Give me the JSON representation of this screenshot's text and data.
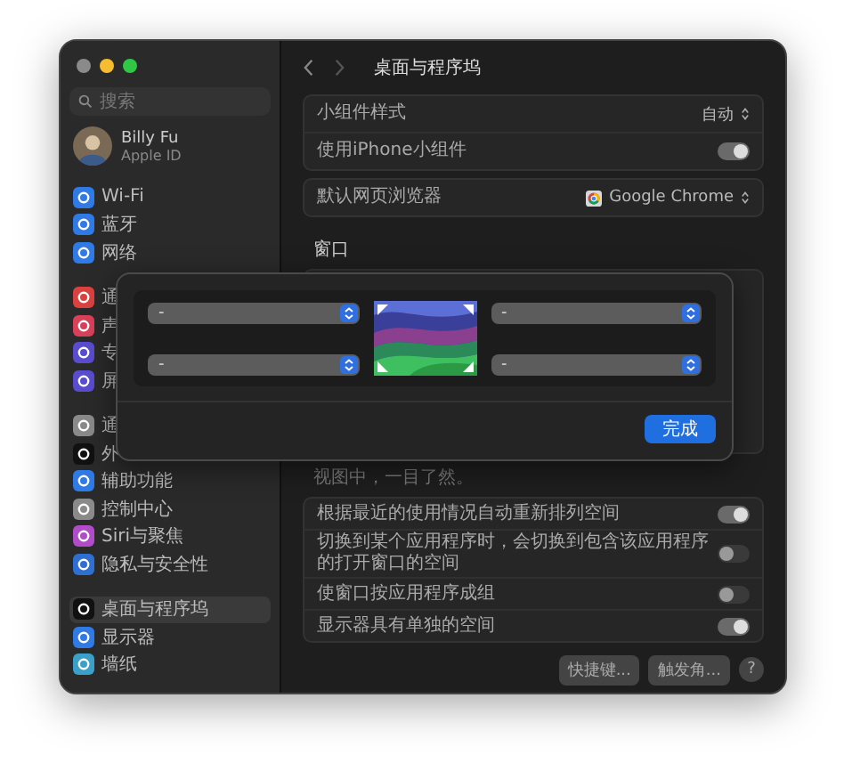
{
  "sidebar": {
    "search": {
      "placeholder": "搜索"
    },
    "account": {
      "name": "Billy Fu",
      "subtitle": "Apple ID"
    },
    "groups": [
      [
        {
          "label": "Wi-Fi",
          "color": "#2f7ae5",
          "selected": false
        },
        {
          "label": "蓝牙",
          "color": "#2f7ae5",
          "selected": false
        },
        {
          "label": "网络",
          "color": "#2f7ae5",
          "selected": false
        }
      ],
      [
        {
          "label": "通",
          "color": "#d9423f",
          "selected": false
        },
        {
          "label": "声",
          "color": "#d9405a",
          "selected": false
        },
        {
          "label": "专",
          "color": "#5a4ccf",
          "selected": false
        },
        {
          "label": "屏",
          "color": "#5a4ccf",
          "selected": false
        }
      ],
      [
        {
          "label": "通",
          "color": "#8a8a8a",
          "selected": false
        },
        {
          "label": "外",
          "color": "#111111",
          "selected": false
        },
        {
          "label": "辅助功能",
          "color": "#2f7ae5",
          "selected": false
        },
        {
          "label": "控制中心",
          "color": "#8a8a8a",
          "selected": false
        },
        {
          "label": "Siri与聚焦",
          "color": "#b04cc8",
          "selected": false
        },
        {
          "label": "隐私与安全性",
          "color": "#2f6fd0",
          "selected": false
        }
      ],
      [
        {
          "label": "桌面与程序坞",
          "color": "#111111",
          "selected": true
        },
        {
          "label": "显示器",
          "color": "#2f7ae5",
          "selected": false
        },
        {
          "label": "墙纸",
          "color": "#3aa0c8",
          "selected": false
        }
      ]
    ]
  },
  "header": {
    "title": "桌面与程序坞"
  },
  "cards": [
    [
      {
        "kind": "popup",
        "label": "小组件样式",
        "value": "自动"
      },
      {
        "kind": "toggle",
        "label": "使用iPhone小组件",
        "on": true
      }
    ],
    [
      {
        "kind": "app",
        "label": "默认网页浏览器",
        "value": "Google Chrome"
      }
    ]
  ],
  "section": "窗口",
  "note": "视图中，一目了然。",
  "spaces": [
    {
      "kind": "toggle",
      "label": "根据最近的使用情况自动重新排列空间",
      "on": true
    },
    {
      "kind": "toggle",
      "label": "切换到某个应用程序时，会切换到包含该应用程序的打开窗口的空间",
      "on": false
    },
    {
      "kind": "toggle",
      "label": "使窗口按应用程序成组",
      "on": false
    },
    {
      "kind": "toggle",
      "label": "显示器具有单独的空间",
      "on": true
    }
  ],
  "footer": {
    "buttons": [
      "快捷键...",
      "触发角..."
    ],
    "help": "?"
  },
  "sheet": {
    "corners": [
      "-",
      "-",
      "-",
      "-"
    ],
    "done": "完成"
  }
}
